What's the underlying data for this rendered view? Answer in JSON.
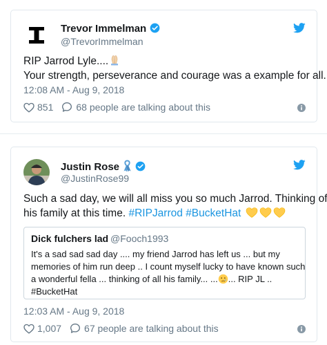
{
  "colors": {
    "link": "#1b95e0",
    "secondary": "#657786",
    "border": "#e1e8ed",
    "verified": "#1da1f2",
    "twitter": "#1da1f2",
    "heart_emoji": "#ffcc4d"
  },
  "tweets": [
    {
      "author_name": "Trevor Immelman",
      "author_handle": "@TrevorImmelman",
      "avatar_icon": "ti-logo",
      "text_lines": [
        "RIP Jarrod Lyle....",
        "Your strength, perseverance and courage was a example for all."
      ],
      "emoji": "folded-hands",
      "timestamp": "12:08 AM - Aug 9, 2018",
      "likes": "851",
      "talking": "68 people are talking about this"
    },
    {
      "author_name": "Justin Rose",
      "author_handle": "@JustinRose99",
      "avatar_icon": "profile-photo",
      "text_line1": "Such a sad day, we will all miss you so much Jarrod. Thinking of",
      "text_line2_plain": "his family at this time. ",
      "hashtag1": "#RIPJarrod",
      "hashtag2": "#BucketHat",
      "quote": {
        "author_name": "Dick fulchers lad",
        "author_handle": "@Fooch1993",
        "lines": [
          "It's a sad sad sad day ....  my friend Jarrod has left us ... but my",
          "memories of him run deep .. I count myself lucky to have known such",
          "a wonderful fella ...  thinking of all his family... ...",
          "#BucketHat"
        ],
        "line3_tail": "... RIP JL .."
      },
      "timestamp": "12:03 AM - Aug 9, 2018",
      "likes": "1,007",
      "talking": "67 people are talking about this"
    }
  ]
}
